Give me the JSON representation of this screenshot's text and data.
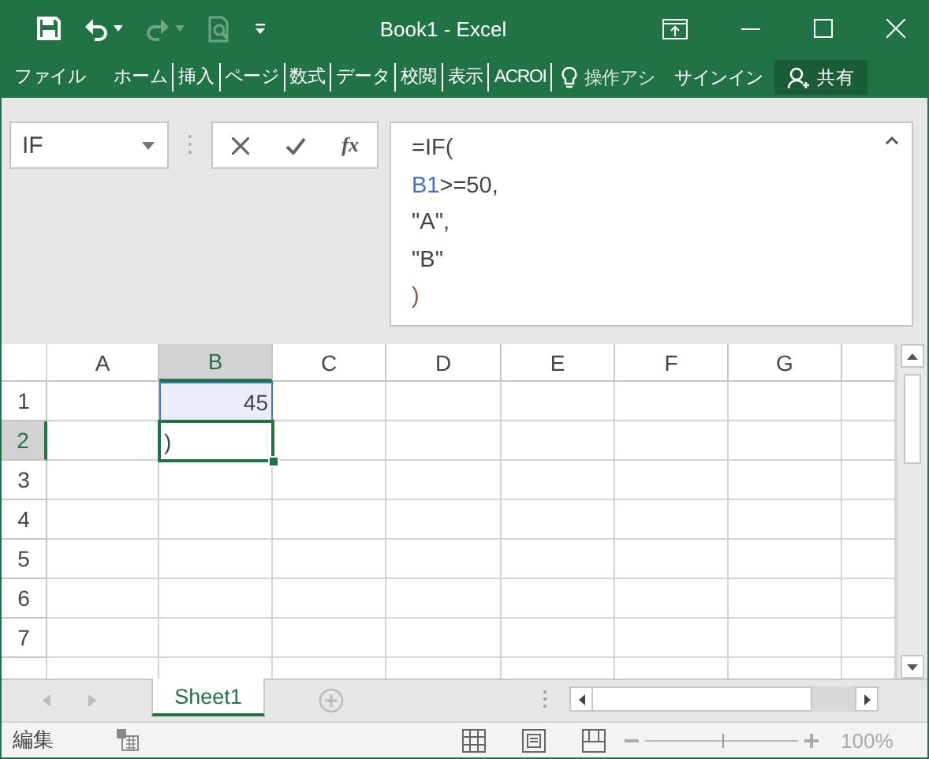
{
  "window": {
    "title": "Book1 - Excel"
  },
  "quick_access": [
    {
      "kind": "save",
      "disabled": false
    },
    {
      "kind": "undo",
      "disabled": false
    },
    {
      "kind": "redo",
      "disabled": true
    },
    {
      "kind": "preview",
      "disabled": true
    },
    {
      "kind": "customize",
      "disabled": false
    }
  ],
  "ribbon": {
    "tabs": [
      "ファイル",
      "ホーム",
      "挿入",
      "ページ",
      "数式",
      "データ",
      "校閲",
      "表示",
      "ACROI"
    ],
    "tell_me": "操作アシ",
    "sign_in": "サインイン",
    "share": "共有"
  },
  "formula_bar": {
    "name_box": "IF",
    "fx": "fx",
    "lines": [
      [
        {
          "text": "=IF(",
          "kind": "plain"
        }
      ],
      [
        {
          "text": "B1",
          "kind": "ref"
        },
        {
          "text": ">=50,",
          "kind": "plain"
        }
      ],
      [
        {
          "text": "\"A\",",
          "kind": "plain"
        }
      ],
      [
        {
          "text": "\"B\"",
          "kind": "plain"
        }
      ],
      [
        {
          "text": ")",
          "kind": "paren"
        }
      ]
    ]
  },
  "grid": {
    "columns": [
      {
        "label": "A",
        "selected": false
      },
      {
        "label": "B",
        "selected": true
      },
      {
        "label": "C",
        "selected": false
      },
      {
        "label": "D",
        "selected": false
      },
      {
        "label": "E",
        "selected": false
      },
      {
        "label": "F",
        "selected": false
      },
      {
        "label": "G",
        "selected": false
      }
    ],
    "rows": [
      {
        "label": "1",
        "selected": false,
        "cells": {
          "B": {
            "text": "45",
            "range_highlight": true,
            "active": false
          }
        }
      },
      {
        "label": "2",
        "selected": true,
        "cells": {
          "B": {
            "text": ")",
            "range_highlight": false,
            "active": true
          }
        }
      },
      {
        "label": "3",
        "selected": false
      },
      {
        "label": "4",
        "selected": false
      },
      {
        "label": "5",
        "selected": false
      },
      {
        "label": "6",
        "selected": false
      },
      {
        "label": "7",
        "selected": false
      }
    ]
  },
  "sheets": [
    {
      "name": "Sheet1",
      "selected": true
    }
  ],
  "status_bar": {
    "mode": "編集",
    "zoom": {
      "level": 0.5,
      "reading": "100%"
    }
  }
}
